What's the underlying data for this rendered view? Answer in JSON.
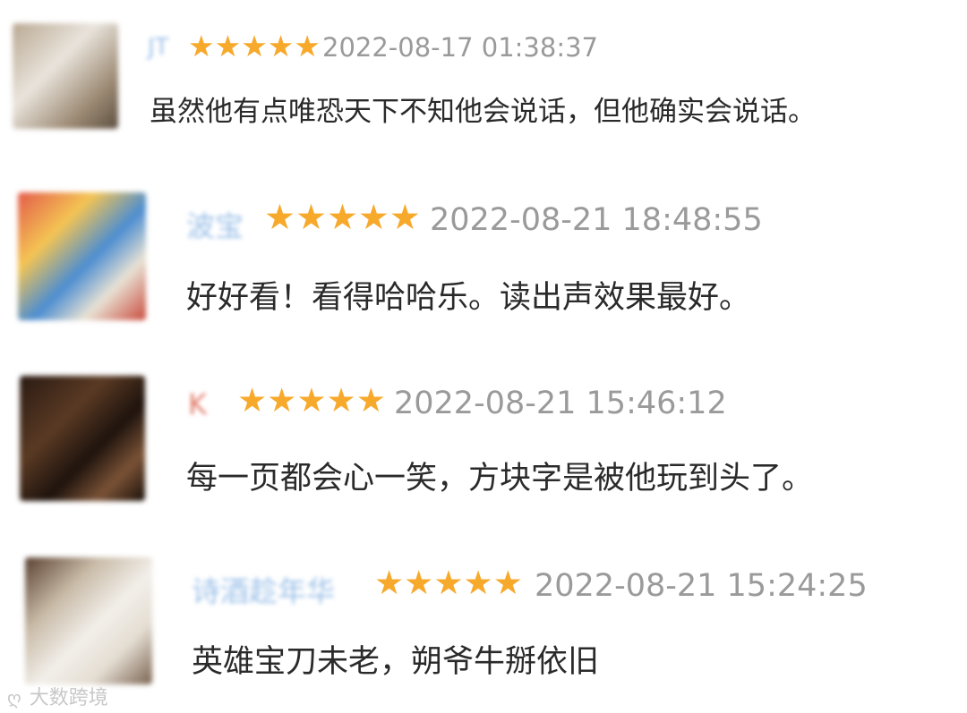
{
  "colors": {
    "star": "#f7a92c",
    "name": "#9cc0e8",
    "timestamp": "#9a9a9a",
    "text": "#2a2a2a"
  },
  "reviews": [
    {
      "user": "JT",
      "rating": 5,
      "time": "2022-08-17 01:38:37",
      "text": "虽然他有点唯恐天下不知他会说话，但他确实会说话。"
    },
    {
      "user": "波宝",
      "rating": 5,
      "time": "2022-08-21 18:48:55",
      "text": "好好看！看得哈哈乐。读出声效果最好。"
    },
    {
      "user": "K",
      "rating": 5,
      "time": "2022-08-21 15:46:12",
      "text": "每一页都会心一笑，方块字是被他玩到头了。"
    },
    {
      "user": "诗酒趁年华",
      "rating": 5,
      "time": "2022-08-21 15:24:25",
      "text": "英雄宝刀未老，朔爷牛掰依旧"
    }
  ],
  "watermark": {
    "icon": "weibo-icon",
    "text": "大数跨境"
  }
}
